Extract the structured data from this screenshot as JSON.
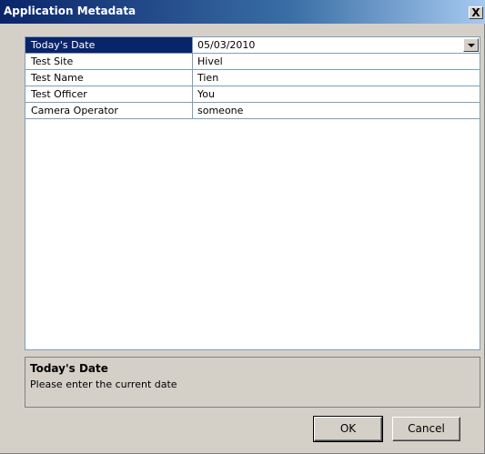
{
  "window": {
    "title": "Application Metadata",
    "close_glyph": "X"
  },
  "properties": [
    {
      "name": "Today's Date",
      "value": "05/03/2010",
      "selected": true,
      "has_dropdown": true
    },
    {
      "name": "Test Site",
      "value": "Hivel"
    },
    {
      "name": "Test Name",
      "value": "Tien"
    },
    {
      "name": "Test Officer",
      "value": "You"
    },
    {
      "name": "Camera Operator",
      "value": "someone"
    }
  ],
  "help": {
    "title": "Today's Date",
    "description": "Please enter the current date"
  },
  "buttons": {
    "ok": "OK",
    "cancel": "Cancel"
  },
  "colors": {
    "titlebar": "#0a246a",
    "selection": "#0a246a",
    "dialog_bg": "#d4d0c8",
    "grid_line": "#7f9db9"
  }
}
